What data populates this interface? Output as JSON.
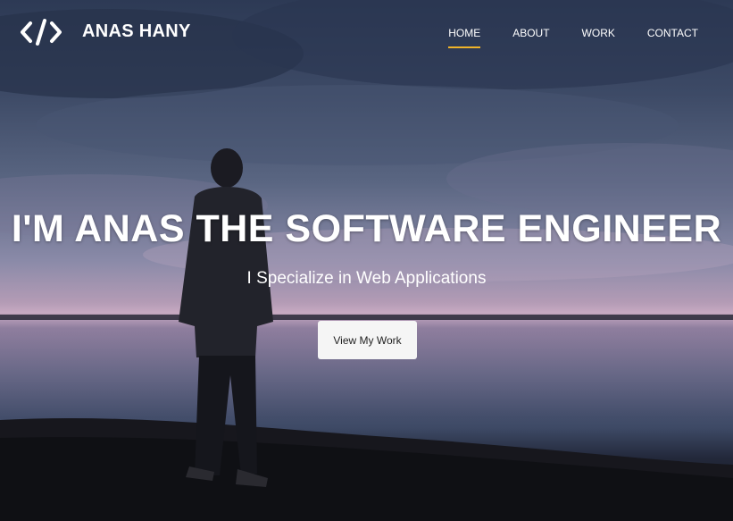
{
  "brand": {
    "name": "ANAS HANY",
    "logo_icon": "code-brackets-icon"
  },
  "nav": {
    "items": [
      {
        "label": "HOME",
        "active": true
      },
      {
        "label": "ABOUT",
        "active": false
      },
      {
        "label": "WORK",
        "active": false
      },
      {
        "label": "CONTACT",
        "active": false
      }
    ],
    "active_underline_color": "#f0b429"
  },
  "hero": {
    "headline": "I'M ANAS THE SOFTWARE ENGINEER",
    "subheadline": "I Specialize in Web Applications",
    "cta_label": "View My Work"
  }
}
